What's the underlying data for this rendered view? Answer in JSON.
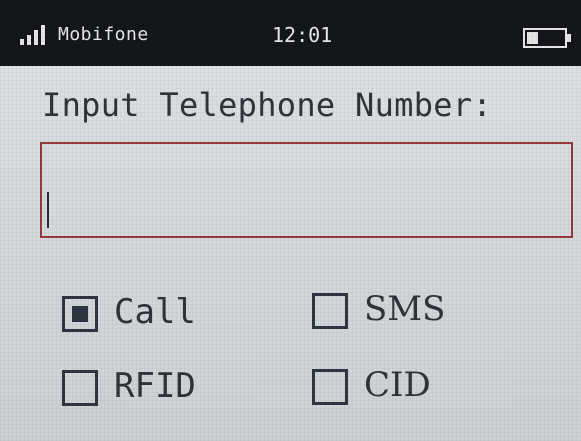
{
  "status_bar": {
    "carrier": "Mobifone",
    "time": "12:01",
    "signal_icon": "signal-bars-icon",
    "battery_icon": "battery-icon",
    "battery_level": 0.3
  },
  "form": {
    "prompt": "Input Telephone Number:",
    "phone_value": ""
  },
  "options": {
    "call": {
      "label": "Call",
      "checked": true
    },
    "sms": {
      "label": "SMS",
      "checked": false
    },
    "rfid": {
      "label": "RFID",
      "checked": false
    },
    "cid": {
      "label": "CID",
      "checked": false
    }
  },
  "colors": {
    "status_bar_bg": "#14161a",
    "input_border": "#9a3a3a",
    "text": "#2f333a"
  }
}
